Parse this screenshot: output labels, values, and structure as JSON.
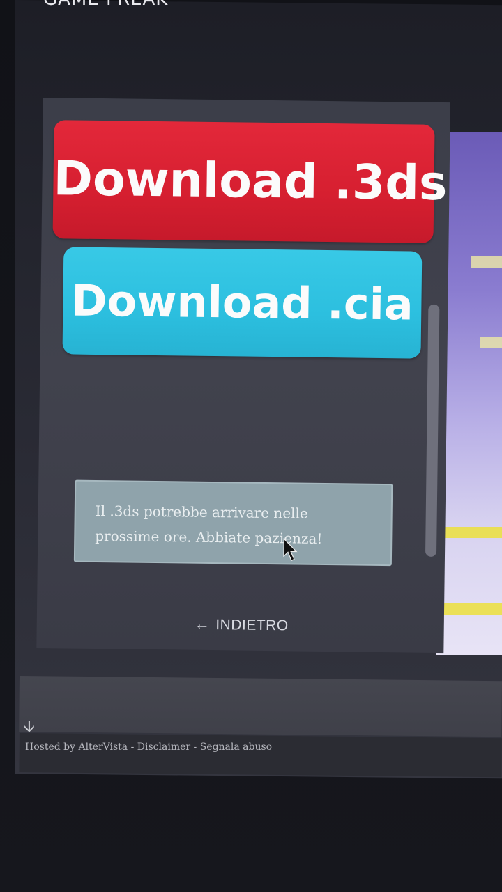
{
  "header": {
    "brand": "GAME FREAK"
  },
  "downloads": {
    "primary_label": "Download .3ds",
    "secondary_label": "Download .cia"
  },
  "notice": {
    "text": "Il .3ds potrebbe arrivare nelle prossime ore. Abbiate pazienza!"
  },
  "nav": {
    "back_label": "INDIETRO",
    "back_icon": "arrow-left-icon"
  },
  "footer": {
    "text": "Hosted by AlterVista - Disclaimer - Segnala abuso",
    "icon": "arrow-down-icon"
  },
  "colors": {
    "download_3ds": "#d61f30",
    "download_cia": "#2cbfdf",
    "panel": "#3f404b",
    "notice_bg": "#8fa3ab"
  }
}
